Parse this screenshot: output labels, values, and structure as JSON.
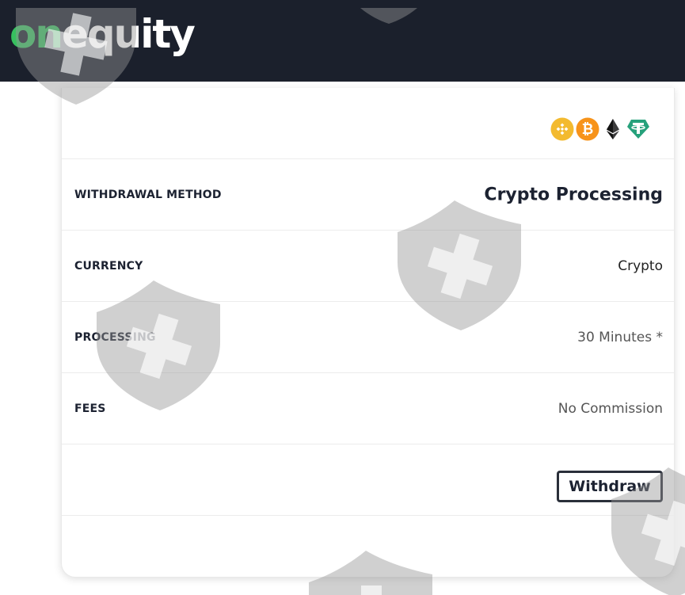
{
  "header": {
    "logo_part1": "on",
    "logo_part2": "equity"
  },
  "payment": {
    "coin_icons": [
      "bnb-icon",
      "bitcoin-icon",
      "ethereum-icon",
      "tether-icon"
    ],
    "coin_colors": {
      "bnb": "#f3ba2f",
      "bitcoin": "#f7931a",
      "ethereum": "#343434",
      "tether": "#26a17b"
    }
  },
  "details": {
    "rows": [
      {
        "label": "WITHDRAWAL METHOD",
        "value": "Crypto Processing"
      },
      {
        "label": "CURRENCY",
        "value": "Crypto"
      },
      {
        "label": "PROCESSING",
        "value": "30 Minutes *"
      },
      {
        "label": "FEES",
        "value": "No Commission"
      }
    ]
  },
  "actions": {
    "withdraw_label": "Withdraw"
  },
  "colors": {
    "header_bg": "#1b202c",
    "brand_green": "#37c05f",
    "text_dark": "#1c2231"
  }
}
